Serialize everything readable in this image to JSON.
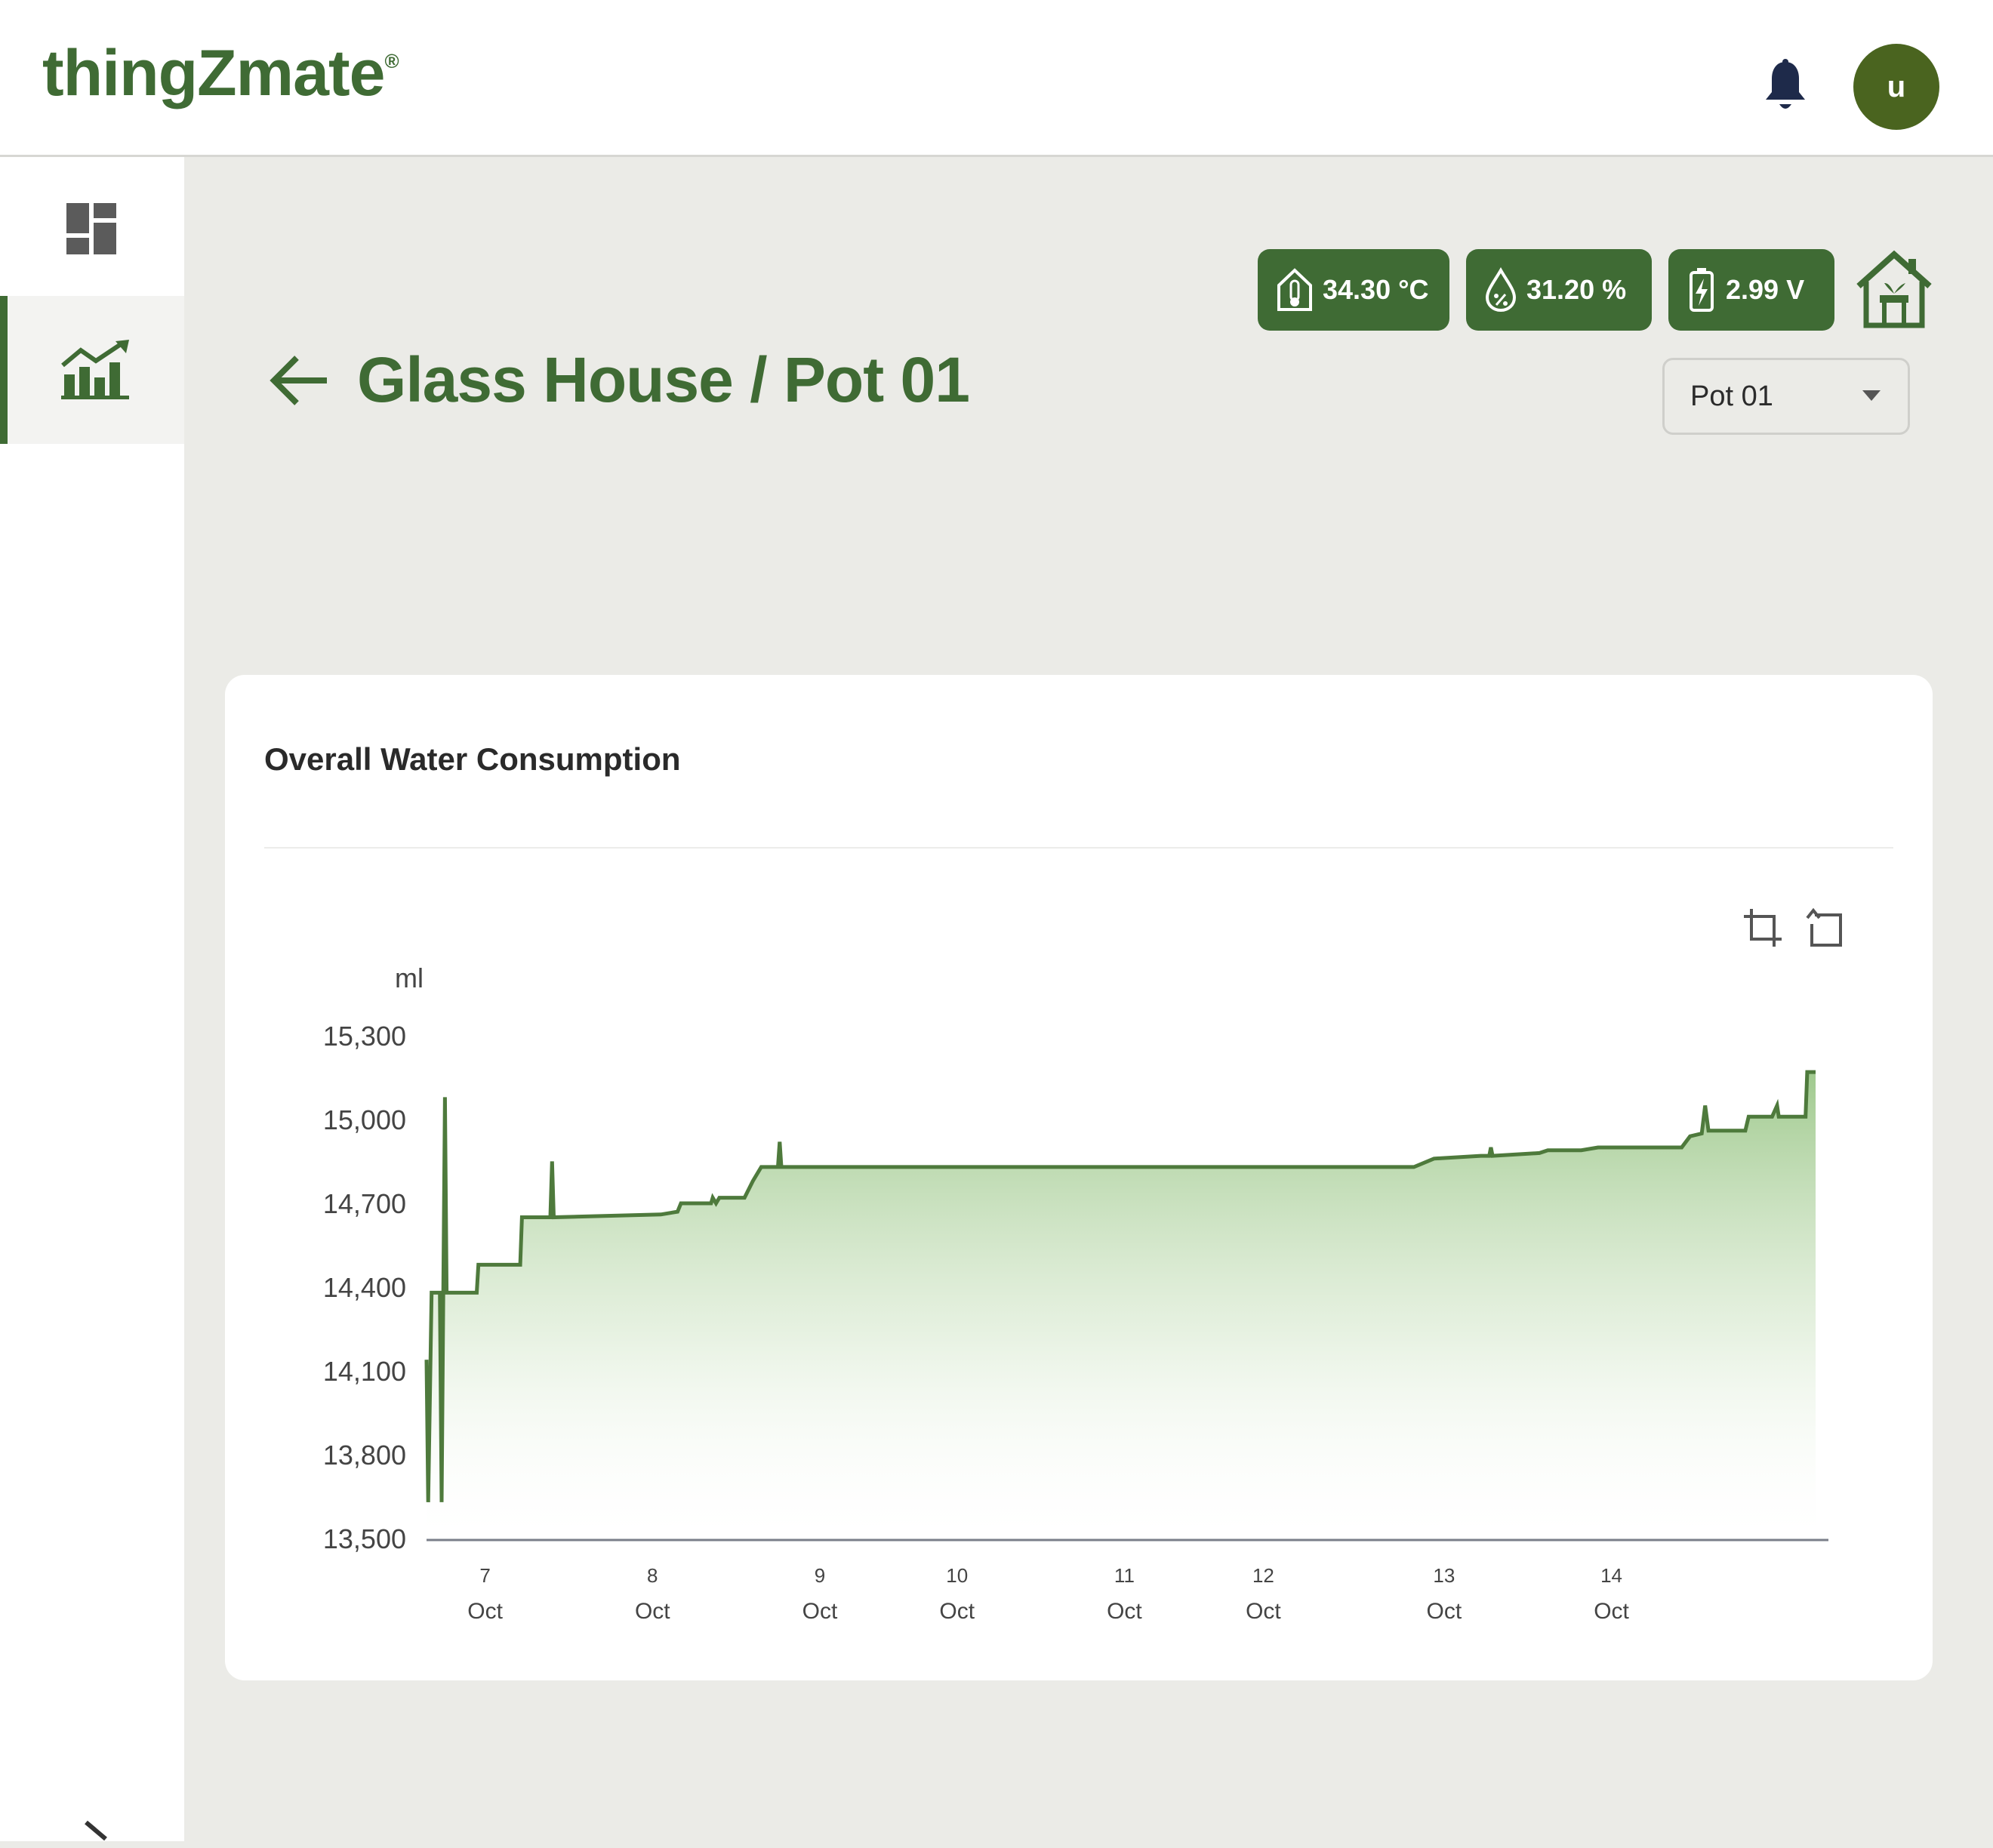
{
  "header": {
    "logo": "thingZmate",
    "logo_mark": "®",
    "avatar_initial": "u"
  },
  "sidebar": {
    "items": [
      {
        "name": "dashboard",
        "icon": "dashboard-grid-icon"
      },
      {
        "name": "analytics",
        "icon": "bar-chart-trend-icon",
        "active": true
      }
    ]
  },
  "page": {
    "title": "Glass House / Pot 01"
  },
  "sensors": {
    "temperature": "34.30 °C",
    "humidity": "31.20 %",
    "battery": "2.99 V"
  },
  "pot_select": {
    "value": "Pot 01"
  },
  "card": {
    "title": "Overall Water Consumption"
  },
  "colors": {
    "brand": "#3f6b34",
    "line": "#4e7a3c",
    "fill_top": "#8fc07a",
    "avatar": "#4a641f"
  },
  "chart_data": {
    "type": "area",
    "title": "Overall Water Consumption",
    "ylabel": "ml",
    "xlabel": "",
    "ylim": [
      13500,
      15300
    ],
    "yticks": [
      13500,
      13800,
      14100,
      14400,
      14700,
      15000,
      15300
    ],
    "ytick_labels": [
      "13,500",
      "13,800",
      "14,100",
      "14,400",
      "14,700",
      "15,000",
      "15,300"
    ],
    "xticks": [
      {
        "day": "7",
        "month": "Oct",
        "x": 6.35
      },
      {
        "day": "8",
        "month": "Oct",
        "x": 7.35
      },
      {
        "day": "9",
        "month": "Oct",
        "x": 8.35
      },
      {
        "day": "10",
        "month": "Oct",
        "x": 9.17
      },
      {
        "day": "11",
        "month": "Oct",
        "x": 10.17
      },
      {
        "day": "12",
        "month": "Oct",
        "x": 11.0
      },
      {
        "day": "13",
        "month": "Oct",
        "x": 12.08
      },
      {
        "day": "14",
        "month": "Oct",
        "x": 13.08
      }
    ],
    "x_range": [
      6.0,
      14.9
    ],
    "series": [
      {
        "points": [
          [
            6.0,
            14140
          ],
          [
            6.01,
            13630
          ],
          [
            6.03,
            14380
          ],
          [
            6.08,
            14380
          ],
          [
            6.09,
            13630
          ],
          [
            6.1,
            14380
          ],
          [
            6.11,
            15080
          ],
          [
            6.12,
            14380
          ],
          [
            6.3,
            14380
          ],
          [
            6.31,
            14480
          ],
          [
            6.56,
            14480
          ],
          [
            6.57,
            14650
          ],
          [
            6.74,
            14650
          ],
          [
            6.75,
            14850
          ],
          [
            6.76,
            14650
          ],
          [
            7.4,
            14660
          ],
          [
            7.5,
            14670
          ],
          [
            7.52,
            14700
          ],
          [
            7.7,
            14700
          ],
          [
            7.71,
            14720
          ],
          [
            7.73,
            14700
          ],
          [
            7.75,
            14720
          ],
          [
            7.9,
            14720
          ],
          [
            7.95,
            14780
          ],
          [
            8.0,
            14830
          ],
          [
            8.1,
            14830
          ],
          [
            8.11,
            14920
          ],
          [
            8.12,
            14830
          ],
          [
            10.4,
            14830
          ],
          [
            11.0,
            14830
          ],
          [
            11.9,
            14830
          ],
          [
            12.02,
            14860
          ],
          [
            12.3,
            14870
          ],
          [
            12.35,
            14870
          ],
          [
            12.36,
            14900
          ],
          [
            12.37,
            14870
          ],
          [
            12.65,
            14880
          ],
          [
            12.7,
            14890
          ],
          [
            12.9,
            14890
          ],
          [
            13.0,
            14900
          ],
          [
            13.5,
            14900
          ],
          [
            13.55,
            14940
          ],
          [
            13.62,
            14950
          ],
          [
            13.64,
            15050
          ],
          [
            13.66,
            14960
          ],
          [
            13.88,
            14960
          ],
          [
            13.9,
            15010
          ],
          [
            14.04,
            15010
          ],
          [
            14.07,
            15050
          ],
          [
            14.08,
            15010
          ],
          [
            14.24,
            15010
          ],
          [
            14.25,
            15170
          ],
          [
            14.3,
            15170
          ]
        ]
      }
    ]
  }
}
